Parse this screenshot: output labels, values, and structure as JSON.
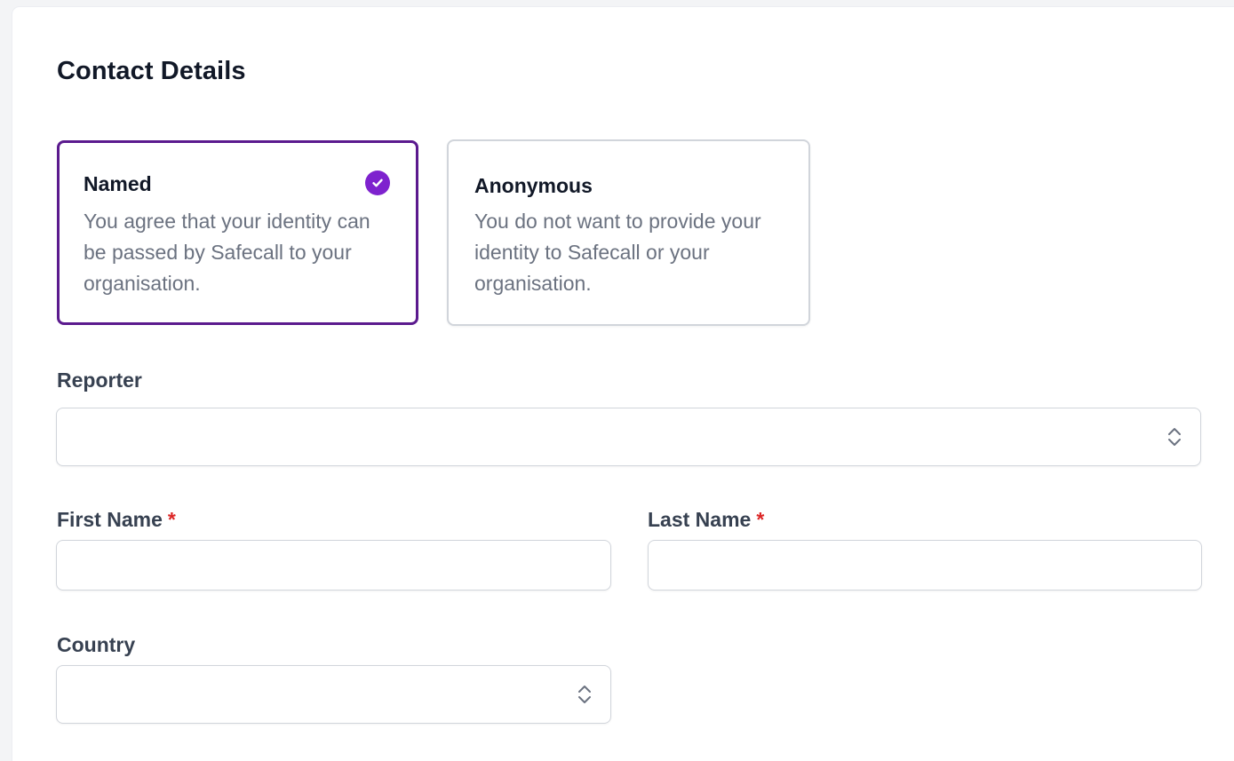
{
  "contact_details": {
    "title": "Contact Details",
    "options": [
      {
        "title": "Named",
        "description": "You agree that your identity can be passed by Safecall to your organisation.",
        "selected": true
      },
      {
        "title": "Anonymous",
        "description": "You do not want to provide your identity to Safecall or your organisation.",
        "selected": false
      }
    ]
  },
  "form": {
    "reporter": {
      "label": "Reporter",
      "value": ""
    },
    "first_name": {
      "label": "First Name",
      "required_marker": "*",
      "value": ""
    },
    "last_name": {
      "label": "Last Name",
      "required_marker": "*",
      "value": ""
    },
    "country": {
      "label": "Country",
      "value": ""
    }
  },
  "colors": {
    "accent": "#7e22ce",
    "selected_border": "#5b1a8e",
    "required": "#dc2626",
    "muted_text": "#6b7280",
    "input_border": "#d1d5db"
  },
  "icons": {
    "check": "check-circle-icon",
    "select": "chevron-up-down-icon"
  }
}
